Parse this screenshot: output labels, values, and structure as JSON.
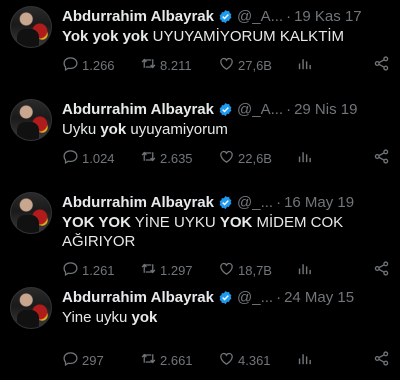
{
  "tweets": [
    {
      "name": "Abdurrahim Albayrak",
      "handle": "@_A...",
      "date": "19 Kas 17",
      "text_parts": [
        {
          "t": "Yok yok yok",
          "b": true
        },
        {
          "t": " UYUYAMİYORUM KALKTİM",
          "b": false
        }
      ],
      "replies": "1.266",
      "retweets": "8.211",
      "likes": "27,6B"
    },
    {
      "name": "Abdurrahim Albayrak",
      "handle": "@_A...",
      "date": "29 Nis 19",
      "text_parts": [
        {
          "t": "Uyku ",
          "b": false
        },
        {
          "t": "yok",
          "b": true
        },
        {
          "t": " uyuyamiyorum",
          "b": false
        }
      ],
      "replies": "1.024",
      "retweets": "2.635",
      "likes": "22,6B"
    },
    {
      "name": "Abdurrahim Albayrak",
      "handle": "@_...",
      "date": "16 May 19",
      "text_parts": [
        {
          "t": "YOK YOK",
          "b": true
        },
        {
          "t": " YİNE UYKU ",
          "b": false
        },
        {
          "t": "YOK",
          "b": true
        },
        {
          "t": " MİDEM COK AĞIRIYOR",
          "b": false
        }
      ],
      "replies": "1.261",
      "retweets": "1.297",
      "likes": "18,7B"
    },
    {
      "name": "Abdurrahim Albayrak",
      "handle": "@_...",
      "date": "24 May 15",
      "text_parts": [
        {
          "t": "Yine uyku ",
          "b": false
        },
        {
          "t": "yok",
          "b": true
        }
      ],
      "replies": "297",
      "retweets": "2.661",
      "likes": "4.361"
    }
  ],
  "icons": {
    "verified": "verified-badge-icon",
    "reply": "reply-icon",
    "retweet": "retweet-icon",
    "like": "heart-icon",
    "views": "views-icon",
    "share": "share-icon"
  },
  "colors": {
    "background": "#000000",
    "text": "#e7e9ea",
    "muted": "#71767b",
    "verified": "#1d9bf0"
  }
}
